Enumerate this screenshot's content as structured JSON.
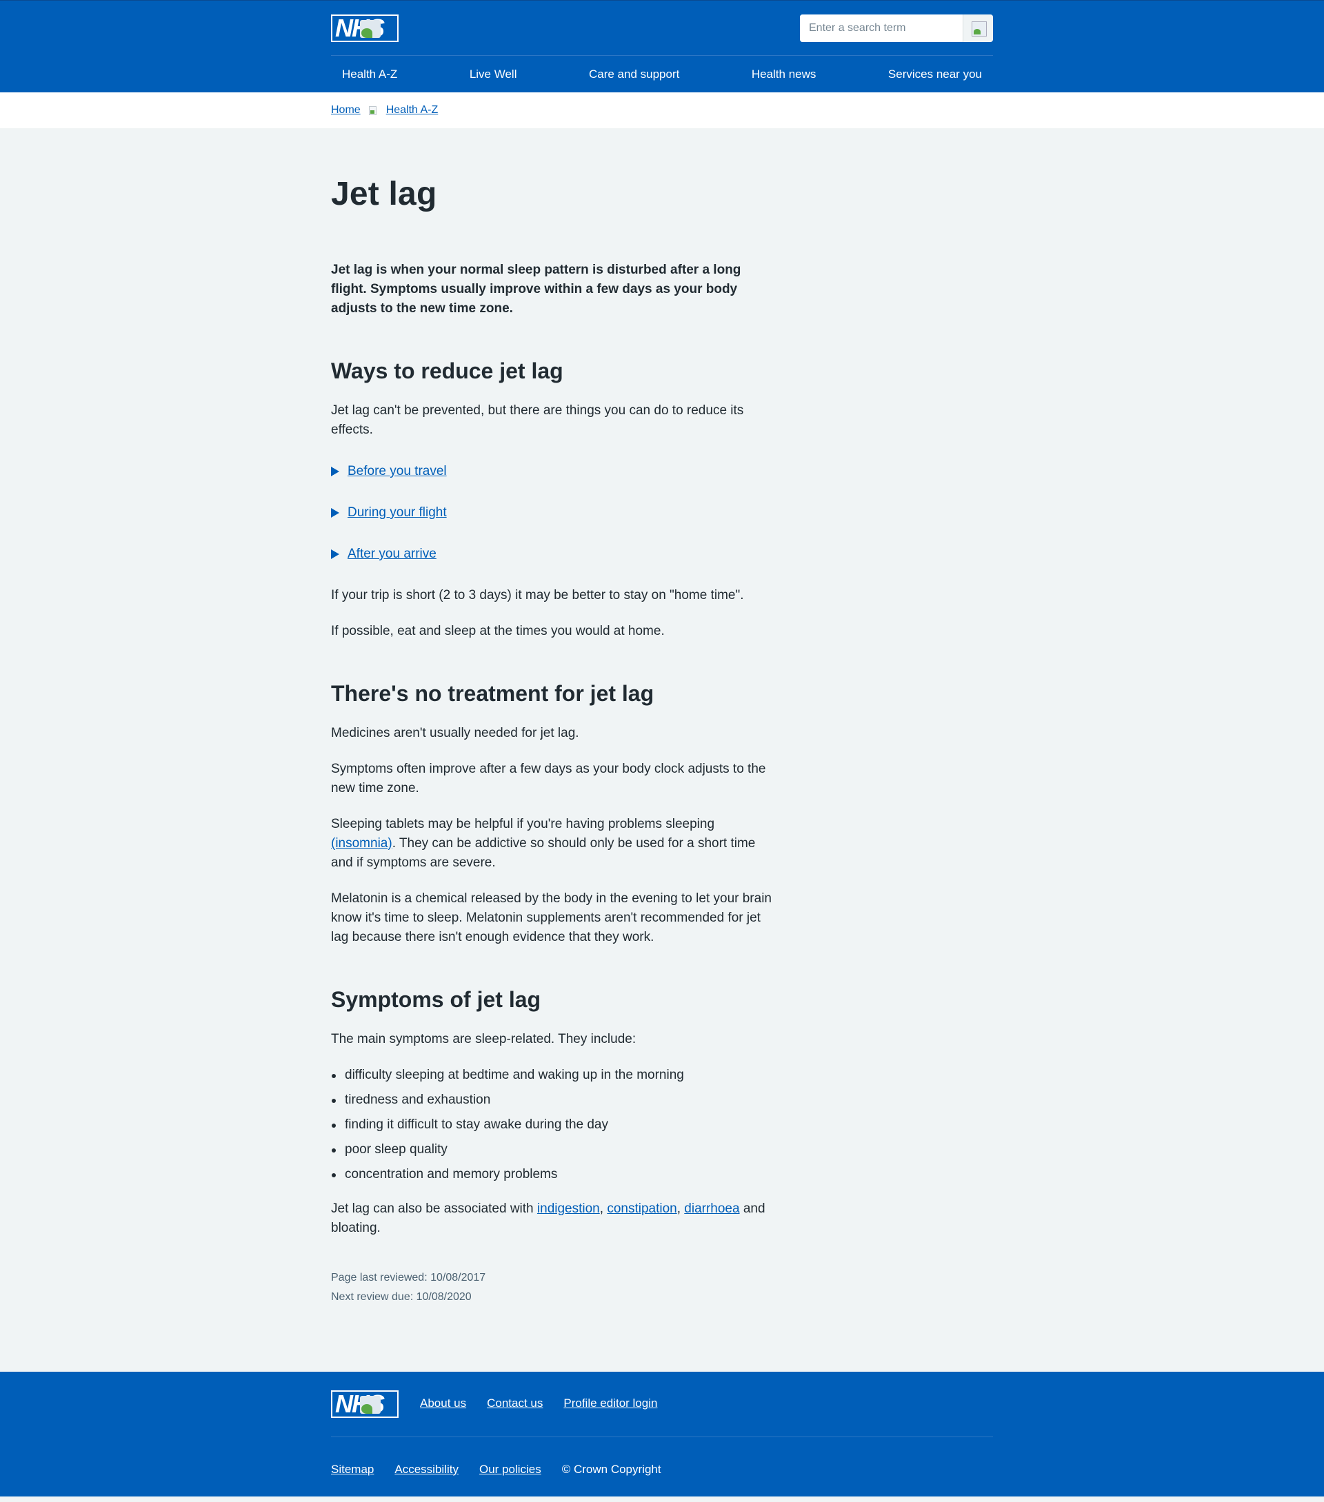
{
  "header": {
    "logo_text": "NHS",
    "search_placeholder": "Enter a search term",
    "nav": [
      {
        "label": "Health A-Z"
      },
      {
        "label": "Live Well"
      },
      {
        "label": "Care and support"
      },
      {
        "label": "Health news"
      },
      {
        "label": "Services near you"
      }
    ]
  },
  "breadcrumb": [
    {
      "label": "Home"
    },
    {
      "label": "Health A-Z"
    }
  ],
  "page": {
    "title": "Jet lag",
    "lede": "Jet lag is when your normal sleep pattern is disturbed after a long flight. Symptoms usually improve within a few days as your body adjusts to the new time zone.",
    "section1": {
      "heading": "Ways to reduce jet lag",
      "intro": "Jet lag can't be prevented, but there are things you can do to reduce its effects.",
      "details": [
        {
          "label": "Before you travel"
        },
        {
          "label": "During your flight"
        },
        {
          "label": "After you arrive"
        }
      ],
      "p1": "If your trip is short (2 to 3 days) it may be better to stay on \"home time\".",
      "p2": "If possible, eat and sleep at the times you would at home."
    },
    "section2": {
      "heading": "There's no treatment for jet lag",
      "p1": "Medicines aren't usually needed for jet lag.",
      "p2": "Symptoms often improve after a few days as your body clock adjusts to the new time zone.",
      "p3_before": "Sleeping tablets may be helpful if you're having problems sleeping ",
      "p3_link": "(insomnia)",
      "p3_after": ". They can be addictive so should only be used for a short time and if symptoms are severe.",
      "p4": "Melatonin is a chemical released by the body in the evening to let your brain know it's time to sleep. Melatonin supplements aren't recommended for jet lag because there isn't enough evidence that they work."
    },
    "section3": {
      "heading": "Symptoms of jet lag",
      "intro": "The main symptoms are sleep-related. They include:",
      "items": [
        "difficulty sleeping at bedtime and waking up in the morning",
        "tiredness and exhaustion",
        "finding it difficult to stay awake during the day",
        "poor sleep quality",
        "concentration and memory problems"
      ],
      "outro_before": "Jet lag can also be associated with ",
      "link_indigestion": "indigestion",
      "comma1": ", ",
      "link_constipation": "constipation",
      "comma2": ", ",
      "link_diarrhoea": "diarrhoea",
      "outro_after": " and bloating."
    },
    "review": {
      "last_reviewed": "Page last reviewed: 10/08/2017",
      "next_due": "Next review due: 10/08/2020"
    }
  },
  "footer": {
    "logo_text": "NHS",
    "top_links": [
      {
        "label": "About us"
      },
      {
        "label": "Contact us"
      },
      {
        "label": "Profile editor login"
      }
    ],
    "bottom_links": [
      {
        "label": "Sitemap"
      },
      {
        "label": "Accessibility"
      },
      {
        "label": "Our policies"
      }
    ],
    "copyright": "© Crown Copyright"
  },
  "colors": {
    "brand_blue": "#005eb8",
    "background": "#f0f4f5",
    "text": "#212b32",
    "secondary_text": "#4c6272"
  }
}
